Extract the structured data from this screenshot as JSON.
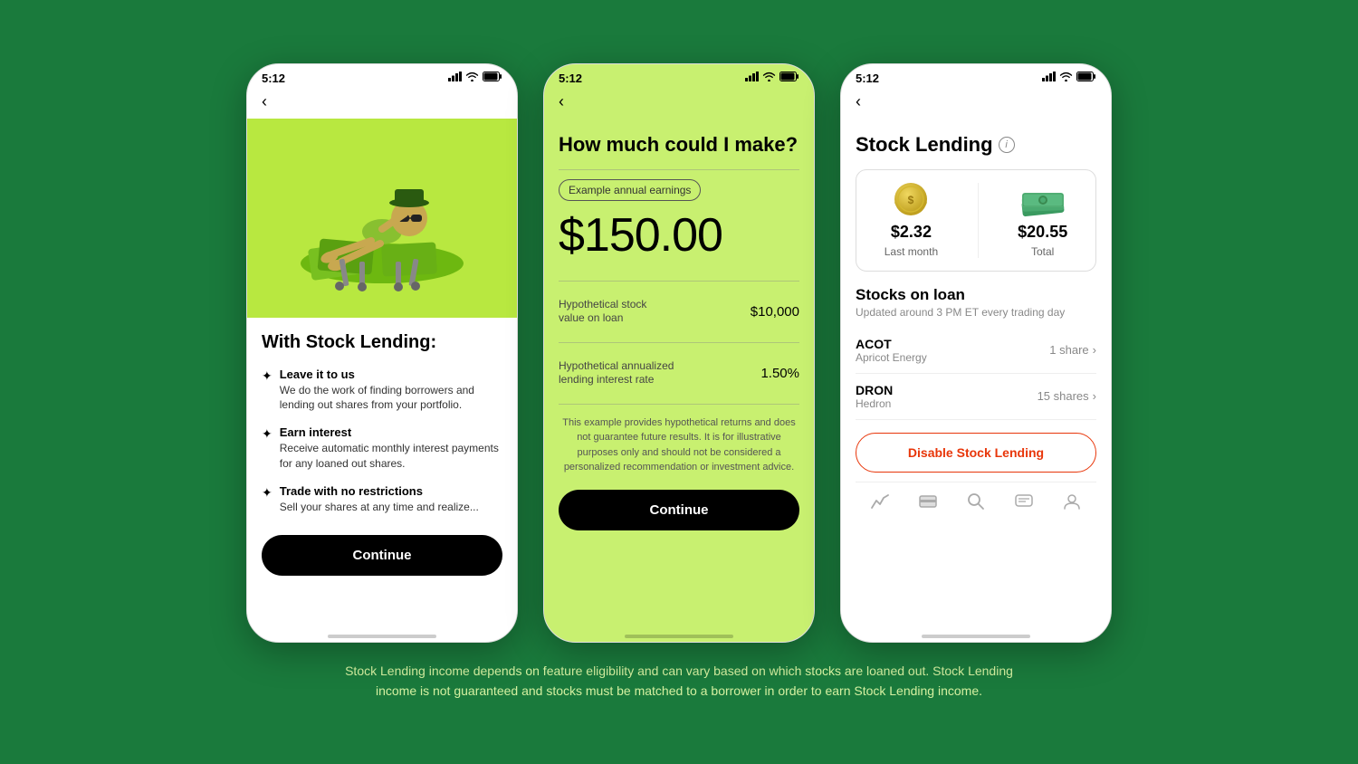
{
  "background_color": "#1a7a3c",
  "footer": {
    "text": "Stock Lending income depends on feature eligibility and can vary based on which stocks are loaned out. Stock Lending income is not guaranteed and stocks must be matched to a borrower in order to earn Stock Lending income."
  },
  "phone1": {
    "status_time": "5:12",
    "title": "With Stock Lending:",
    "features": [
      {
        "title": "Leave it to us",
        "desc": "We do the work of finding borrowers and lending out shares from your portfolio."
      },
      {
        "title": "Earn interest",
        "desc": "Receive automatic monthly interest payments for any loaned out shares."
      },
      {
        "title": "Trade with no restrictions",
        "desc": "Sell your shares at any time and realize..."
      }
    ],
    "continue_label": "Continue"
  },
  "phone2": {
    "status_time": "5:12",
    "title": "How much could I make?",
    "earnings_badge": "Example annual earnings",
    "big_amount": "$150.00",
    "calc_rows": [
      {
        "label": "Hypothetical stock\nvalue on loan",
        "value": "$10,000"
      },
      {
        "label": "Hypothetical annualized\nlending interest rate",
        "value": "1.50%"
      }
    ],
    "disclaimer": "This example provides hypothetical returns and does not guarantee future results. It is for illustrative purposes only and should not be considered a personalized recommendation or investment advice.",
    "continue_label": "Continue"
  },
  "phone3": {
    "status_time": "5:12",
    "title": "Stock Lending",
    "earnings": [
      {
        "amount": "$2.32",
        "label": "Last month",
        "icon": "coin"
      },
      {
        "amount": "$20.55",
        "label": "Total",
        "icon": "money-stack"
      }
    ],
    "stocks_section_title": "Stocks on loan",
    "stocks_section_subtitle": "Updated around 3 PM ET every trading day",
    "stocks": [
      {
        "ticker": "ACOT",
        "name": "Apricot Energy",
        "shares": "1 share"
      },
      {
        "ticker": "DRON",
        "name": "Hedron",
        "shares": "15 shares"
      }
    ],
    "disable_label": "Disable Stock Lending",
    "nav_icons": [
      "chart-icon",
      "card-icon",
      "search-icon",
      "chat-icon",
      "profile-icon"
    ]
  }
}
